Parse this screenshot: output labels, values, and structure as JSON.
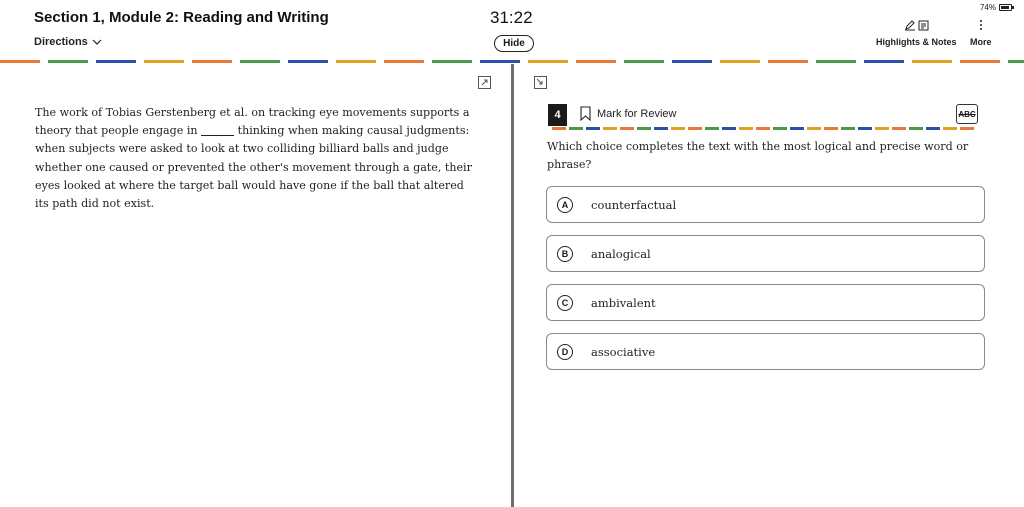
{
  "header": {
    "section_title": "Section 1, Module 2: Reading and Writing",
    "directions_label": "Directions",
    "timer": "31:22",
    "hide_label": "Hide",
    "battery": "74%",
    "highlights_label": "Highlights & Notes",
    "more_label": "More"
  },
  "passage": {
    "before_blank": "The work of Tobias Gerstenberg et al. on tracking eye movements supports a theory that people engage in",
    "after_blank": "thinking when making causal judgments: when subjects were asked to look at two colliding billiard balls and judge whether one caused or prevented the other's movement through a gate, their eyes looked at where the target ball would have gone if the ball that altered its path did not exist."
  },
  "question": {
    "number": "4",
    "mark_label": "Mark for Review",
    "abc_label": "ABC",
    "prompt": "Which choice completes the text with the most logical and precise word or phrase?",
    "choices": [
      {
        "letter": "A",
        "text": "counterfactual"
      },
      {
        "letter": "B",
        "text": "analogical"
      },
      {
        "letter": "C",
        "text": "ambivalent"
      },
      {
        "letter": "D",
        "text": "associative"
      }
    ]
  },
  "colors": {
    "dash": [
      "#e8793b",
      "#4a9a4a",
      "#2f4fa8",
      "#e0a020"
    ],
    "divider": "#6e6e6e"
  },
  "icons": [
    "chevron-down-icon",
    "pen-icon",
    "note-icon",
    "more-vertical-icon",
    "battery-icon",
    "expand-icon",
    "collapse-icon",
    "bookmark-icon",
    "abc-strike-icon"
  ]
}
